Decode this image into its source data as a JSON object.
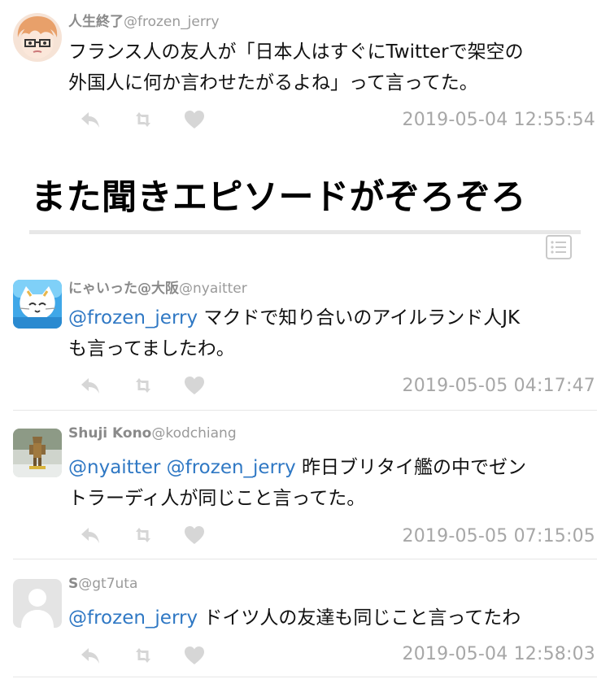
{
  "tweets": [
    {
      "display_name": "人生終了",
      "handle": "@frozen_jerry",
      "mentions": "",
      "text_line1": "フランス人の友人が「日本人はすぐにTwitterで架空の",
      "text_line2": "外国人に何か言わせたがるよね」って言ってた。",
      "timestamp": "2019-05-04 12:55:54",
      "avatar": "anime-boy-avatar"
    },
    {
      "display_name": "にゃいった@大阪",
      "handle": "@nyaitter",
      "mentions": "@frozen_jerry",
      "text_line1": " マクドで知り合いのアイルランド人JK",
      "text_line2": "も言ってましたわ。",
      "timestamp": "2019-05-05 04:17:47",
      "avatar": "cat-avatar"
    },
    {
      "display_name": "Shuji Kono",
      "handle": "@kodchiang",
      "mentions": "@nyaitter @frozen_jerry",
      "text_line1": " 昨日ブリタイ艦の中でゼン",
      "text_line2": "トラーディ人が同じこと言ってた。",
      "timestamp": "2019-05-05 07:15:05",
      "avatar": "figure-avatar"
    },
    {
      "display_name": "S",
      "handle": "@gt7uta",
      "mentions": "@frozen_jerry",
      "text_line1": " ドイツ人の友達も同じこと言ってたわ",
      "text_line2": "",
      "timestamp": "2019-05-04 12:58:03",
      "avatar": "default-avatar"
    }
  ],
  "headline": "また聞きエピソードがぞろぞろ",
  "icons": {
    "reply": "reply-icon",
    "retweet": "retweet-icon",
    "like": "heart-icon",
    "list": "list-icon"
  },
  "colors": {
    "mention": "#2f78c4",
    "timestamp": "#a7a7a7",
    "action_icon": "#d6d6d6"
  }
}
